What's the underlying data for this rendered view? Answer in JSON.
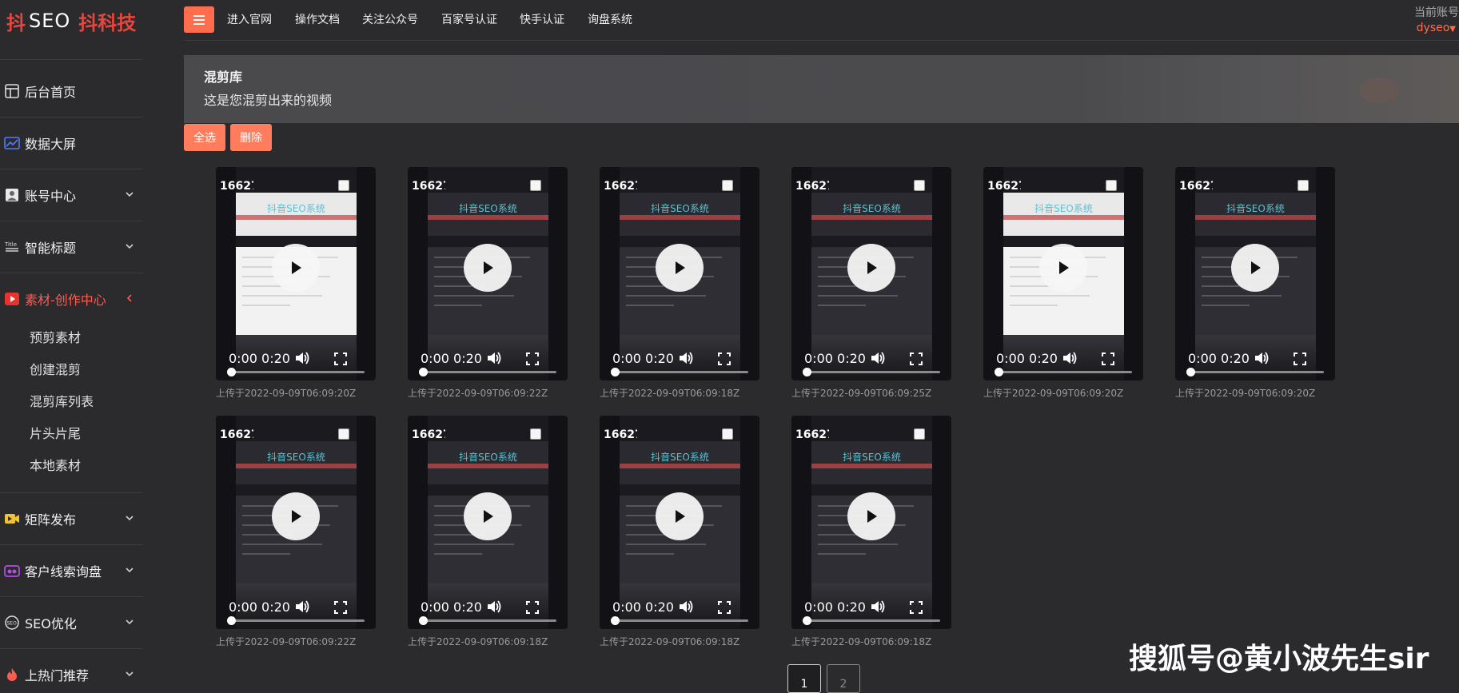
{
  "brand": {
    "logo_part1": "抖",
    "logo_part2": "SEO",
    "logo_part3": "抖科技"
  },
  "sidebar": {
    "items": [
      {
        "label": "后台首页",
        "icon": "dashboard-icon"
      },
      {
        "label": "数据大屏",
        "icon": "chart-icon"
      },
      {
        "label": "账号中心",
        "icon": "user-icon"
      },
      {
        "label": "智能标题",
        "icon": "title-icon"
      },
      {
        "label": "素材-创作中心",
        "icon": "video-icon"
      },
      {
        "label": "矩阵发布",
        "icon": "camera-icon"
      },
      {
        "label": "客户线索询盘",
        "icon": "leads-icon"
      },
      {
        "label": "SEO优化",
        "icon": "seo-icon"
      },
      {
        "label": "上热门推荐",
        "icon": "fire-icon"
      }
    ],
    "sub_items": [
      "预剪素材",
      "创建混剪",
      "混剪库列表",
      "片头片尾",
      "本地素材"
    ]
  },
  "topnav": {
    "links": [
      "进入官网",
      "操作文档",
      "关注公众号",
      "百家号认证",
      "快手认证",
      "询盘系统"
    ],
    "account_label": "当前账号",
    "account_user": "dyseo"
  },
  "banner": {
    "title": "混剪库",
    "description": "这是您混剪出来的视频"
  },
  "actions": {
    "select_all": "全选",
    "delete": "删除"
  },
  "videos": [
    {
      "id": "16627(",
      "time": "0:00 0:20",
      "video_title": "抖音SEO系统",
      "uploaded": "上传于2022-09-09T06:09:20Z"
    },
    {
      "id": "16627(",
      "time": "0:00 0:20",
      "video_title": "抖音SEO系统",
      "uploaded": "上传于2022-09-09T06:09:22Z"
    },
    {
      "id": "16627(",
      "time": "0:00 0:20",
      "video_title": "抖音SEO系统",
      "uploaded": "上传于2022-09-09T06:09:18Z"
    },
    {
      "id": "16627(",
      "time": "0:00 0:20",
      "video_title": "抖音SEO系统",
      "uploaded": "上传于2022-09-09T06:09:25Z"
    },
    {
      "id": "16627(",
      "time": "0:00 0:20",
      "video_title": "抖音SEO系统",
      "uploaded": "上传于2022-09-09T06:09:20Z"
    },
    {
      "id": "16627(",
      "time": "0:00 0:20",
      "video_title": "抖音SEO系统",
      "uploaded": "上传于2022-09-09T06:09:20Z"
    },
    {
      "id": "16627(",
      "time": "0:00 0:20",
      "video_title": "抖音SEO系统",
      "uploaded": "上传于2022-09-09T06:09:22Z"
    },
    {
      "id": "16627(",
      "time": "0:00 0:20",
      "video_title": "抖音SEO系统",
      "uploaded": "上传于2022-09-09T06:09:18Z"
    },
    {
      "id": "16627(",
      "time": "0:00 0:20",
      "video_title": "抖音SEO系统",
      "uploaded": "上传于2022-09-09T06:09:18Z"
    },
    {
      "id": "16627(",
      "time": "0:00 0:20",
      "video_title": "抖音SEO系统",
      "uploaded": "上传于2022-09-09T06:09:18Z"
    }
  ],
  "pagination": {
    "pages": [
      "1",
      "2"
    ],
    "current": "1"
  },
  "watermark": "搜狐号@黄小波先生sir",
  "colors": {
    "accent": "#ff6d4f",
    "active_menu": "#ff5a4e",
    "background": "#2b2b2e"
  }
}
